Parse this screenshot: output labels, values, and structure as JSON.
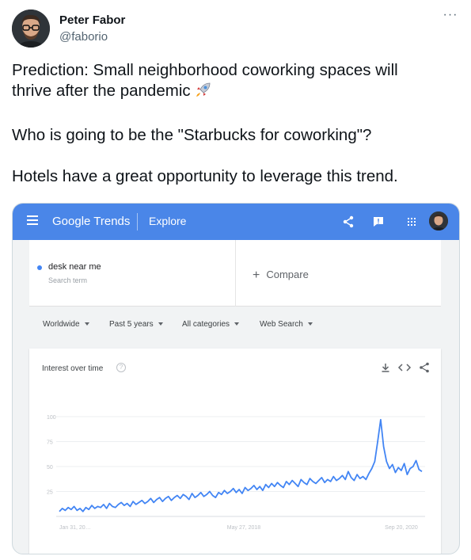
{
  "tweet": {
    "author_name": "Peter Fabor",
    "author_handle": "@faborio",
    "more_label": "···",
    "lines": [
      "Prediction: Small neighborhood coworking spaces will",
      "thrive after the pandemic",
      "Who is going to be the \"Starbucks for coworking\"?",
      "Hotels have a great opportunity to leverage this trend."
    ]
  },
  "trends": {
    "logo_google": "Google",
    "logo_trends": " Trends",
    "explore": "Explore",
    "search_term": "desk near me",
    "search_term_sub": "Search term",
    "compare": "Compare",
    "filters": [
      "Worldwide",
      "Past 5 years",
      "All categories",
      "Web Search"
    ],
    "chart_title": "Interest over time",
    "help": "?",
    "colors": {
      "bar": "#4a86e8",
      "line": "#4285f4",
      "dot": "#4285f4"
    }
  },
  "chart_data": {
    "type": "line",
    "title": "Interest over time",
    "xlabel": "",
    "ylabel": "",
    "ylim": [
      0,
      100
    ],
    "yticks": [
      100,
      75,
      50,
      25
    ],
    "x_tick_labels": [
      "Jan 31, 20…",
      "May 27, 2018",
      "Sep 20, 2020"
    ],
    "x_range": [
      "2016-01-31",
      "2021-01-24"
    ],
    "grid": true,
    "series": [
      {
        "values": [
          5,
          8,
          6,
          9,
          7,
          10,
          6,
          8,
          5,
          9,
          7,
          11,
          8,
          10,
          9,
          12,
          8,
          13,
          10,
          9,
          12,
          14,
          11,
          13,
          10,
          15,
          12,
          14,
          16,
          13,
          15,
          18,
          14,
          17,
          19,
          15,
          18,
          20,
          16,
          19,
          21,
          18,
          22,
          20,
          17,
          23,
          19,
          21,
          24,
          20,
          22,
          25,
          21,
          19,
          24,
          22,
          26,
          23,
          25,
          28,
          24,
          27,
          23,
          29,
          26,
          28,
          31,
          27,
          30,
          26,
          32,
          29,
          33,
          30,
          34,
          31,
          29,
          35,
          32,
          36,
          33,
          30,
          37,
          34,
          32,
          38,
          35,
          33,
          36,
          39,
          34,
          37,
          35,
          40,
          36,
          38,
          41,
          37,
          45,
          39,
          36,
          42,
          38,
          40,
          37,
          43,
          48,
          55,
          75,
          97,
          70,
          55,
          48,
          52,
          44,
          49,
          46,
          53,
          42,
          48,
          50,
          56,
          47,
          45
        ]
      }
    ]
  }
}
